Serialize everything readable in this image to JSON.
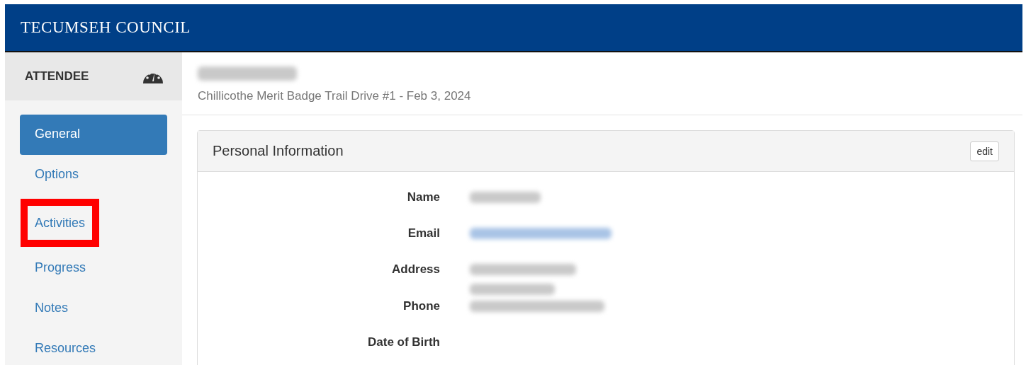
{
  "banner": {
    "title": "TECUMSEH COUNCIL"
  },
  "sidebar": {
    "heading": "ATTENDEE",
    "items": [
      {
        "label": "General",
        "selected": true,
        "highlighted": false
      },
      {
        "label": "Options",
        "selected": false,
        "highlighted": false
      },
      {
        "label": "Activities",
        "selected": false,
        "highlighted": true
      },
      {
        "label": "Progress",
        "selected": false,
        "highlighted": false
      },
      {
        "label": "Notes",
        "selected": false,
        "highlighted": false
      },
      {
        "label": "Resources",
        "selected": false,
        "highlighted": false
      }
    ]
  },
  "header": {
    "name": {
      "kind": "redacted"
    },
    "subtitle": "Chillicothe Merit Badge Trail Drive #1 - Feb 3, 2024"
  },
  "panel": {
    "title": "Personal Information",
    "button": "edit",
    "fields": [
      {
        "label": "Name",
        "values": [
          {
            "kind": "redacted-text"
          }
        ]
      },
      {
        "label": "Email",
        "values": [
          {
            "kind": "redacted-link"
          }
        ]
      },
      {
        "label": "Address",
        "values": [
          {
            "kind": "redacted-text"
          },
          {
            "kind": "redacted-text"
          }
        ]
      },
      {
        "label": "Phone",
        "values": [
          {
            "kind": "redacted-text"
          }
        ]
      },
      {
        "label": "Date of Birth"
      }
    ]
  }
}
